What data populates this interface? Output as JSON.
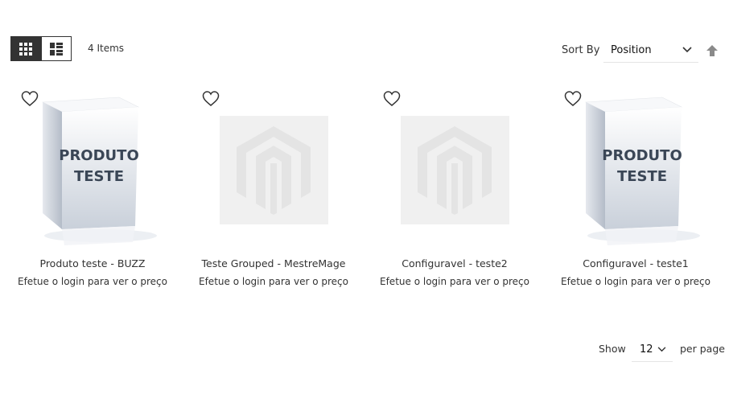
{
  "toolbar": {
    "view_modes": [
      {
        "name": "grid-mode",
        "active": true
      },
      {
        "name": "list-mode",
        "active": false
      }
    ],
    "amount_text": "4 Items",
    "sort_label": "Sort By",
    "sort_value": "Position",
    "sort_direction_icon": "arrow-up-icon",
    "accent_color": "#333333"
  },
  "products": [
    {
      "name": "Produto teste - BUZZ",
      "price_text": "Efetue o login para ver o preço",
      "image": "box",
      "box_text": [
        "PRODUTO",
        "TESTE"
      ]
    },
    {
      "name": "Teste Grouped - MestreMage",
      "price_text": "Efetue o login para ver o preço",
      "image": "placeholder"
    },
    {
      "name": "Configuravel - teste2",
      "price_text": "Efetue o login para ver o preço",
      "image": "placeholder"
    },
    {
      "name": "Configuravel - teste1",
      "price_text": "Efetue o login para ver o preço",
      "image": "box",
      "box_text": [
        "PRODUTO",
        "TESTE"
      ]
    }
  ],
  "limiter": {
    "show_label": "Show",
    "value": "12",
    "per_page_label": "per page"
  }
}
